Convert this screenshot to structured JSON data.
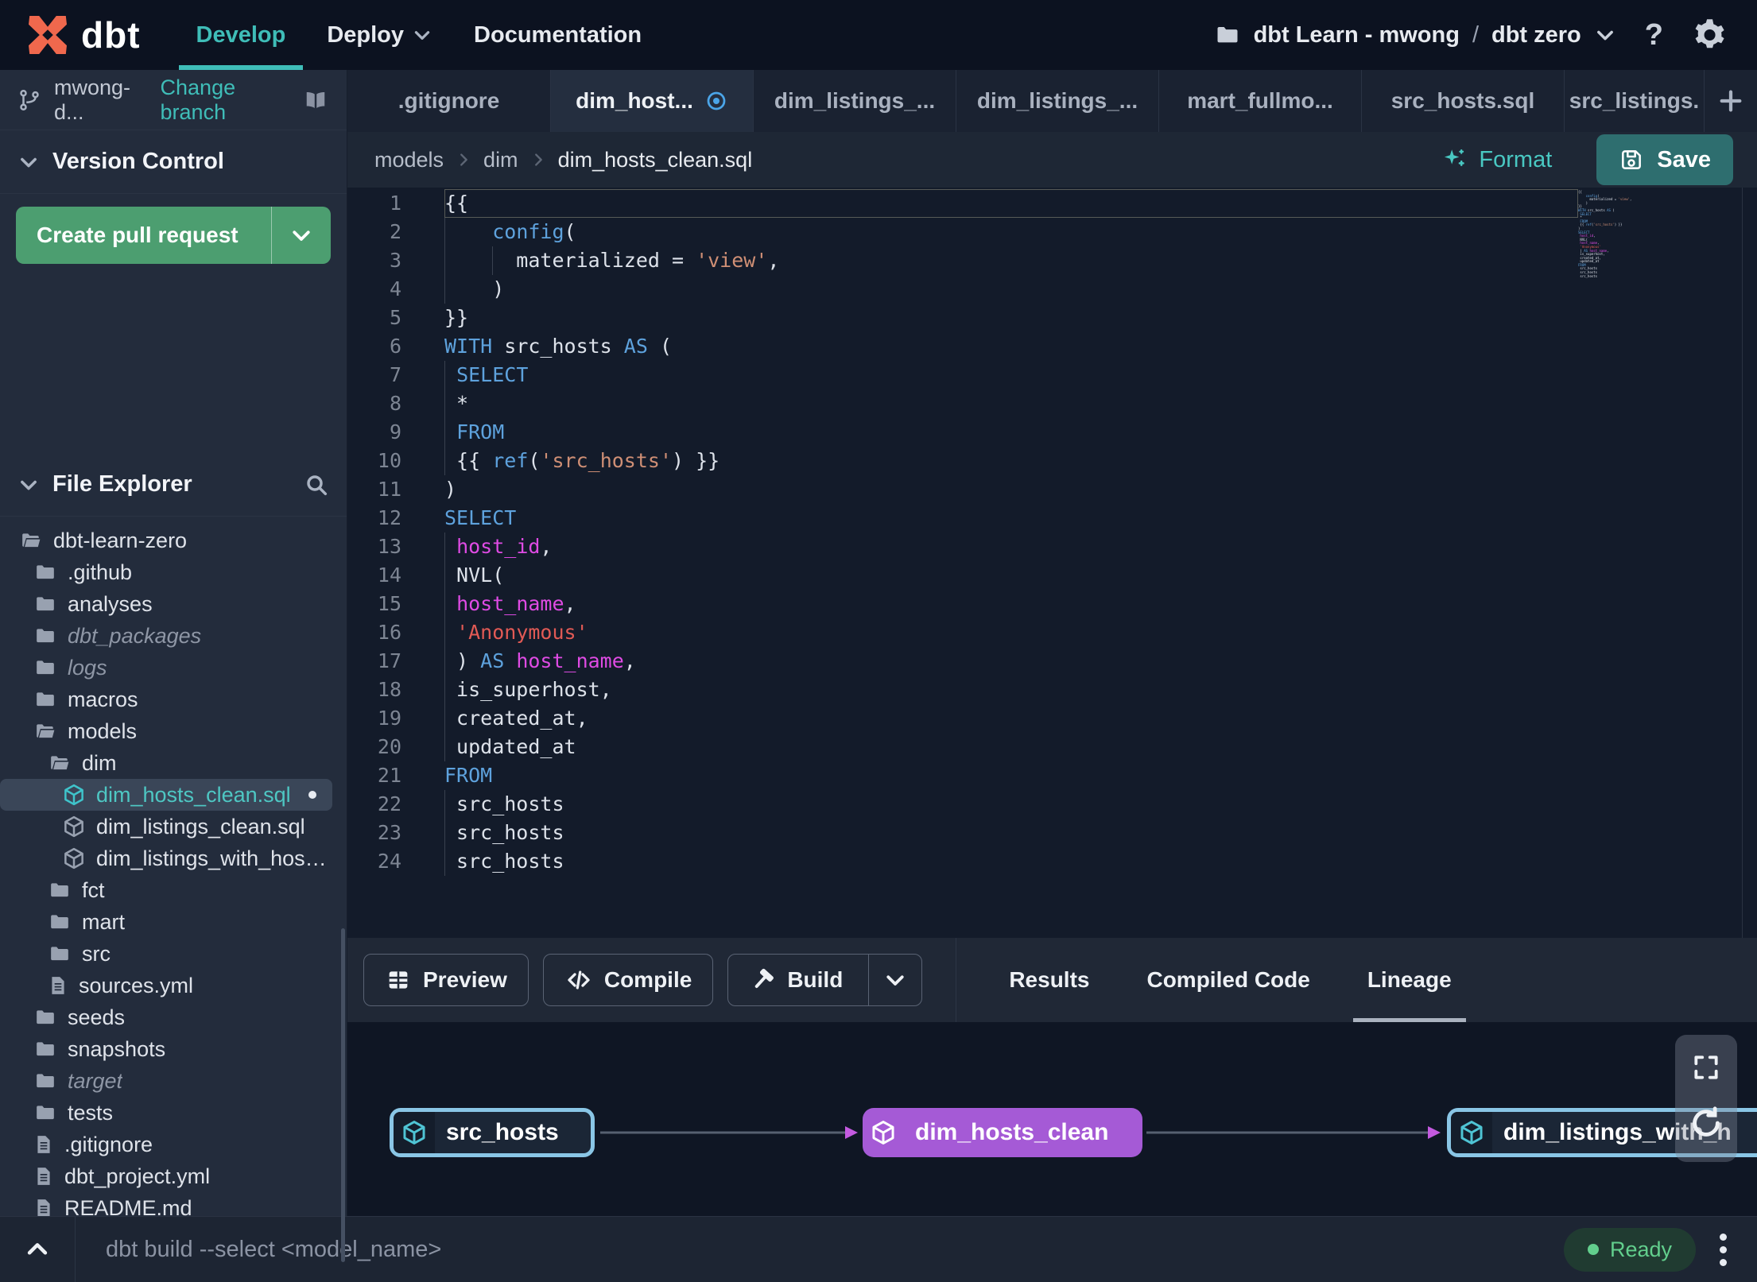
{
  "header": {
    "logo_text": "dbt",
    "nav": [
      {
        "label": "Develop",
        "active": true
      },
      {
        "label": "Deploy",
        "has_chevron": true
      },
      {
        "label": "Documentation"
      }
    ],
    "project": {
      "account": "dbt Learn - mwong",
      "separator": "/",
      "project": "dbt zero"
    },
    "help_label": "?"
  },
  "sidebar": {
    "branch": {
      "name": "mwong-d...",
      "change_branch": "Change branch"
    },
    "version_control": {
      "title": "Version Control",
      "create_pr": "Create pull request"
    },
    "file_explorer": {
      "title": "File Explorer",
      "tree": [
        {
          "label": "dbt-learn-zero",
          "depth": 0,
          "icon": "folder-open"
        },
        {
          "label": ".github",
          "depth": 1,
          "icon": "folder"
        },
        {
          "label": "analyses",
          "depth": 1,
          "icon": "folder"
        },
        {
          "label": "dbt_packages",
          "depth": 1,
          "icon": "folder",
          "muted": true
        },
        {
          "label": "logs",
          "depth": 1,
          "icon": "folder",
          "muted": true
        },
        {
          "label": "macros",
          "depth": 1,
          "icon": "folder"
        },
        {
          "label": "models",
          "depth": 1,
          "icon": "folder-open"
        },
        {
          "label": "dim",
          "depth": 2,
          "icon": "folder-open"
        },
        {
          "label": "dim_hosts_clean.sql",
          "depth": 3,
          "icon": "model",
          "selected": true,
          "dirty": true
        },
        {
          "label": "dim_listings_clean.sql",
          "depth": 3,
          "icon": "model"
        },
        {
          "label": "dim_listings_with_hosts...",
          "depth": 3,
          "icon": "model"
        },
        {
          "label": "fct",
          "depth": 2,
          "icon": "folder"
        },
        {
          "label": "mart",
          "depth": 2,
          "icon": "folder"
        },
        {
          "label": "src",
          "depth": 2,
          "icon": "folder"
        },
        {
          "label": "sources.yml",
          "depth": 2,
          "icon": "file"
        },
        {
          "label": "seeds",
          "depth": 1,
          "icon": "folder"
        },
        {
          "label": "snapshots",
          "depth": 1,
          "icon": "folder"
        },
        {
          "label": "target",
          "depth": 1,
          "icon": "folder",
          "muted": true
        },
        {
          "label": "tests",
          "depth": 1,
          "icon": "folder"
        },
        {
          "label": ".gitignore",
          "depth": 1,
          "icon": "file"
        },
        {
          "label": "dbt_project.yml",
          "depth": 1,
          "icon": "file"
        },
        {
          "label": "README.md",
          "depth": 1,
          "icon": "file"
        }
      ]
    }
  },
  "tabs": {
    "items": [
      {
        "label": ".gitignore"
      },
      {
        "label": "dim_host...",
        "active": true,
        "dirty": true
      },
      {
        "label": "dim_listings_..."
      },
      {
        "label": "dim_listings_..."
      },
      {
        "label": "mart_fullmo..."
      },
      {
        "label": "src_hosts.sql"
      },
      {
        "label": "src_listings.",
        "narrow": true
      }
    ]
  },
  "pathbar": {
    "breadcrumb": [
      "models",
      "dim",
      "dim_hosts_clean.sql"
    ],
    "format_label": "Format",
    "save_label": "Save"
  },
  "editor": {
    "lines": [
      {
        "num": 1,
        "active": true,
        "guides": [],
        "segments": [
          [
            "p",
            "{{"
          ]
        ]
      },
      {
        "num": 2,
        "guides": [
          0
        ],
        "segments": [
          [
            "p",
            "    "
          ],
          [
            "f",
            "config"
          ],
          [
            "p",
            "("
          ]
        ]
      },
      {
        "num": 3,
        "guides": [
          0,
          4
        ],
        "segments": [
          [
            "p",
            "      materialized = "
          ],
          [
            "s",
            "'view'"
          ],
          [
            "p",
            ","
          ]
        ]
      },
      {
        "num": 4,
        "guides": [
          0
        ],
        "segments": [
          [
            "p",
            "    )"
          ]
        ]
      },
      {
        "num": 5,
        "guides": [],
        "segments": [
          [
            "p",
            "}}"
          ]
        ]
      },
      {
        "num": 6,
        "guides": [],
        "segments": [
          [
            "k",
            "WITH"
          ],
          [
            "p",
            " src_hosts "
          ],
          [
            "k",
            "AS"
          ],
          [
            "p",
            " ("
          ]
        ]
      },
      {
        "num": 7,
        "guides": [
          0
        ],
        "segments": [
          [
            "p",
            " "
          ],
          [
            "k",
            "SELECT"
          ]
        ]
      },
      {
        "num": 8,
        "guides": [
          0
        ],
        "segments": [
          [
            "p",
            " *"
          ]
        ]
      },
      {
        "num": 9,
        "guides": [
          0
        ],
        "segments": [
          [
            "p",
            " "
          ],
          [
            "k",
            "FROM"
          ]
        ]
      },
      {
        "num": 10,
        "guides": [
          0
        ],
        "segments": [
          [
            "p",
            " {{ "
          ],
          [
            "f",
            "ref"
          ],
          [
            "p",
            "("
          ],
          [
            "s",
            "'src_hosts'"
          ],
          [
            "p",
            ") }}"
          ]
        ]
      },
      {
        "num": 11,
        "guides": [],
        "segments": [
          [
            "p",
            ")"
          ]
        ]
      },
      {
        "num": 12,
        "guides": [],
        "segments": [
          [
            "k",
            "SELECT"
          ]
        ]
      },
      {
        "num": 13,
        "guides": [
          0
        ],
        "segments": [
          [
            "p",
            " "
          ],
          [
            "m",
            "host_id"
          ],
          [
            "p",
            ","
          ]
        ]
      },
      {
        "num": 14,
        "guides": [
          0
        ],
        "segments": [
          [
            "p",
            " NVL("
          ]
        ]
      },
      {
        "num": 15,
        "guides": [
          0
        ],
        "segments": [
          [
            "p",
            " "
          ],
          [
            "m",
            "host_name"
          ],
          [
            "p",
            ","
          ]
        ]
      },
      {
        "num": 16,
        "guides": [
          0
        ],
        "segments": [
          [
            "p",
            " "
          ],
          [
            "r",
            "'Anonymous'"
          ]
        ]
      },
      {
        "num": 17,
        "guides": [
          0
        ],
        "segments": [
          [
            "p",
            " ) "
          ],
          [
            "k",
            "AS"
          ],
          [
            "p",
            " "
          ],
          [
            "m",
            "host_name"
          ],
          [
            "p",
            ","
          ]
        ]
      },
      {
        "num": 18,
        "guides": [
          0
        ],
        "segments": [
          [
            "p",
            " is_superhost,"
          ]
        ]
      },
      {
        "num": 19,
        "guides": [
          0
        ],
        "segments": [
          [
            "p",
            " created_at,"
          ]
        ]
      },
      {
        "num": 20,
        "guides": [
          0
        ],
        "segments": [
          [
            "p",
            " updated_at"
          ]
        ]
      },
      {
        "num": 21,
        "guides": [],
        "segments": [
          [
            "k",
            "FROM"
          ]
        ]
      },
      {
        "num": 22,
        "guides": [
          0
        ],
        "segments": [
          [
            "p",
            " src_hosts"
          ]
        ]
      },
      {
        "num": 23,
        "guides": [
          0
        ],
        "segments": [
          [
            "p",
            " src_hosts"
          ]
        ]
      },
      {
        "num": 24,
        "guides": [
          0
        ],
        "segments": [
          [
            "p",
            " src_hosts"
          ]
        ]
      }
    ]
  },
  "panel": {
    "buttons": [
      {
        "label": "Preview",
        "icon": "grid"
      },
      {
        "label": "Compile",
        "icon": "code"
      },
      {
        "label": "Build",
        "icon": "hammer",
        "split": true
      }
    ],
    "tabs": [
      {
        "label": "Results"
      },
      {
        "label": "Compiled Code"
      },
      {
        "label": "Lineage",
        "active": true
      }
    ]
  },
  "lineage": {
    "nodes": [
      {
        "label": "src_hosts",
        "style": "outlined"
      },
      {
        "label": "dim_hosts_clean",
        "style": "filled"
      },
      {
        "label": "dim_listings_with_h",
        "style": "outlined"
      }
    ]
  },
  "statusbar": {
    "command_placeholder": "dbt build --select <model_name>",
    "status": "Ready"
  },
  "colors": {
    "brand_orange": "#f0684d",
    "accent_teal": "#3fbdb8",
    "save_teal": "#2e6e6f",
    "pr_green": "#4c9e70",
    "node_blue": "#8ac6e6",
    "node_purple": "#a55ad6",
    "ready_green": "#62cf8d",
    "dirty_blue": "#4ba5e8"
  }
}
